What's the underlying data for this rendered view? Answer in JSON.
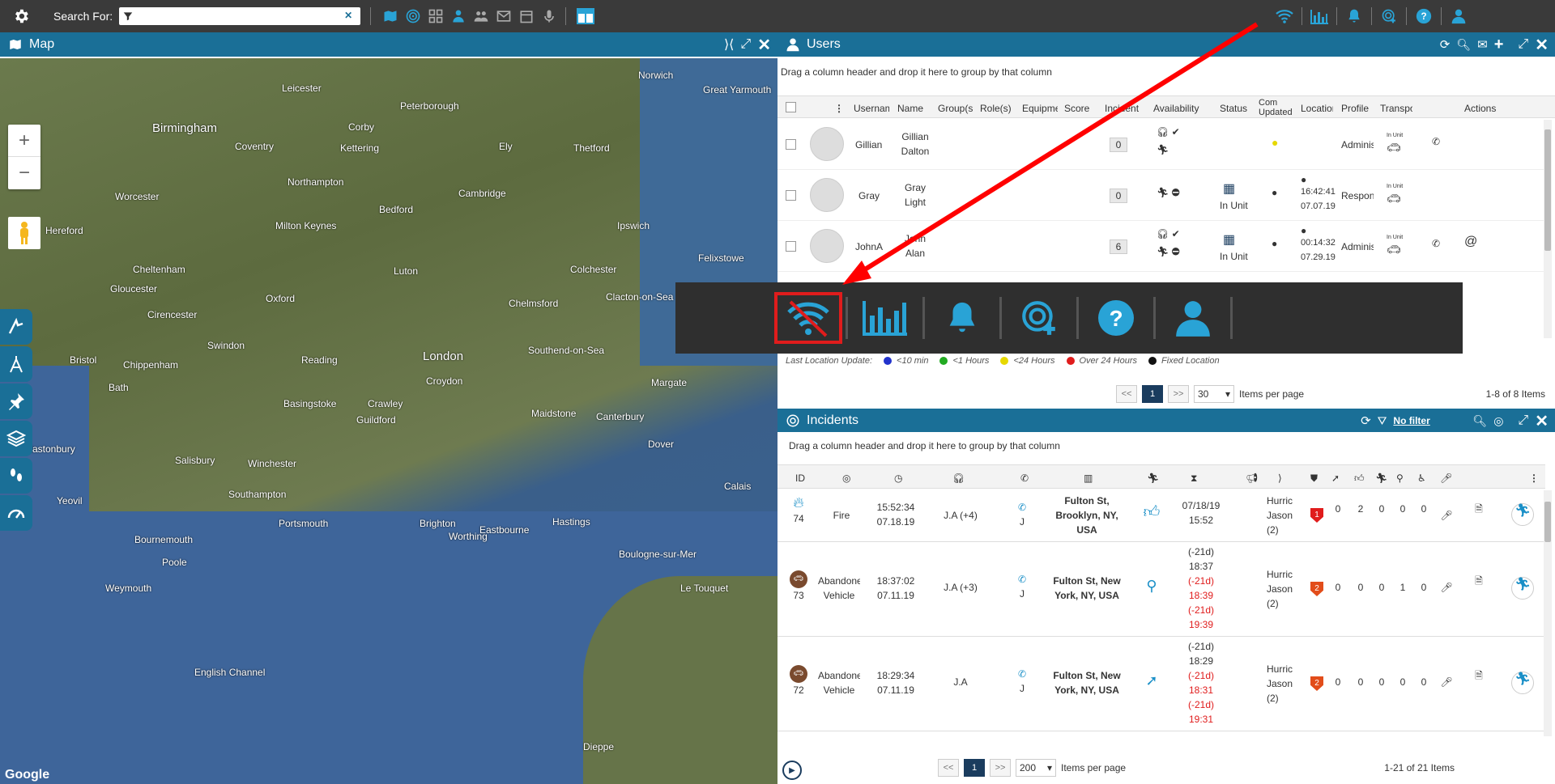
{
  "topbar": {
    "search_label": "Search For:",
    "search_value": "",
    "clear_glyph": "✕"
  },
  "map": {
    "title": "Map",
    "zoom_in": "+",
    "zoom_out": "−",
    "attribution": "Google",
    "cities": [
      {
        "name": "Birmingham",
        "big": true
      },
      {
        "name": "London",
        "big": true
      },
      {
        "name": "Norwich",
        "big": false
      },
      {
        "name": "Cambridge",
        "big": false
      },
      {
        "name": "Oxford",
        "big": false
      },
      {
        "name": "Bristol",
        "big": false
      },
      {
        "name": "Reading",
        "big": false
      },
      {
        "name": "Southampton",
        "big": false
      },
      {
        "name": "Portsmouth",
        "big": false
      },
      {
        "name": "Brighton",
        "big": false
      },
      {
        "name": "Canterbury",
        "big": false
      },
      {
        "name": "Dover",
        "big": false
      },
      {
        "name": "Ipswich",
        "big": false
      },
      {
        "name": "Chelmsford",
        "big": false
      },
      {
        "name": "Colchester",
        "big": false
      },
      {
        "name": "Northampton",
        "big": false
      },
      {
        "name": "Milton Keynes",
        "big": false
      },
      {
        "name": "Bedford",
        "big": false
      },
      {
        "name": "Luton",
        "big": false
      },
      {
        "name": "Swindon",
        "big": false
      },
      {
        "name": "Salisbury",
        "big": false
      },
      {
        "name": "Winchester",
        "big": false
      },
      {
        "name": "Bournemouth",
        "big": false
      },
      {
        "name": "Poole",
        "big": false
      },
      {
        "name": "Weymouth",
        "big": false
      },
      {
        "name": "Worthing",
        "big": false
      },
      {
        "name": "Eastbourne",
        "big": false
      },
      {
        "name": "Hastings",
        "big": false
      },
      {
        "name": "Maidstone",
        "big": false
      },
      {
        "name": "Crawley",
        "big": false
      },
      {
        "name": "Southend-on-Sea",
        "big": false
      },
      {
        "name": "Leicester",
        "big": false
      },
      {
        "name": "Peterborough",
        "big": false
      },
      {
        "name": "Coventry",
        "big": false
      },
      {
        "name": "Gloucester",
        "big": false
      },
      {
        "name": "Cheltenham",
        "big": false
      },
      {
        "name": "Hereford",
        "big": false
      },
      {
        "name": "Worcester",
        "big": false
      },
      {
        "name": "Calais",
        "big": false
      },
      {
        "name": "Boulogne-sur-Mer",
        "big": false
      },
      {
        "name": "Dieppe",
        "big": false
      },
      {
        "name": "Le Touquet",
        "big": false
      },
      {
        "name": "Margate",
        "big": false
      },
      {
        "name": "Clacton-on-Sea",
        "big": false
      },
      {
        "name": "Felixstowe",
        "big": false
      },
      {
        "name": "Great Yarmouth",
        "big": false
      },
      {
        "name": "Thetford",
        "big": false
      },
      {
        "name": "Ely",
        "big": false
      },
      {
        "name": "Kettering",
        "big": false
      },
      {
        "name": "Corby",
        "big": false
      },
      {
        "name": "Basingstoke",
        "big": false
      },
      {
        "name": "Guildford",
        "big": false
      },
      {
        "name": "Croydon",
        "big": false
      },
      {
        "name": "Bath",
        "big": false
      },
      {
        "name": "Chippenham",
        "big": false
      },
      {
        "name": "Cirencester",
        "big": false
      },
      {
        "name": "Yeovil",
        "big": false
      },
      {
        "name": "Glastonbury",
        "big": false
      },
      {
        "name": "English Channel",
        "big": false
      }
    ]
  },
  "users": {
    "title": "Users",
    "group_hint": "Drag a column header and drop it here to group by that column",
    "columns": [
      "Usernam",
      "Name",
      "Group(s",
      "Role(s)",
      "Equipme",
      "Score",
      "Incident",
      "Availability",
      "Status",
      "Com Updated",
      "Location",
      "Profile",
      "Transpo",
      "Actions"
    ],
    "rows": [
      {
        "username": "Gillian",
        "name_first": "Gillian",
        "name_last": "Dalton",
        "incidents": "0",
        "status": "",
        "loc_time": "",
        "loc_date": "",
        "profile": "Adminis",
        "transport": "In Unit"
      },
      {
        "username": "Gray",
        "name_first": "Gray",
        "name_last": "Light",
        "incidents": "0",
        "status": "In Unit",
        "loc_time": "16:42:41",
        "loc_date": "07.07.19",
        "profile": "Respon",
        "transport": "In Unit"
      },
      {
        "username": "JohnA",
        "name_first": "John",
        "name_last": "Alan",
        "incidents": "6",
        "status": "In Unit",
        "loc_time": "00:14:32",
        "loc_date": "07.29.19",
        "profile": "Adminis",
        "transport": "In Unit"
      }
    ],
    "legend": {
      "label": "Last Location Update:",
      "items": [
        {
          "label": "<10 min",
          "color": "#2233cc"
        },
        {
          "label": "<1 Hours",
          "color": "#22aa22"
        },
        {
          "label": "<24 Hours",
          "color": "#e6d800"
        },
        {
          "label": "Over 24 Hours",
          "color": "#e01c1c"
        },
        {
          "label": "Fixed Location",
          "color": "#111111"
        }
      ]
    },
    "pager": {
      "prev": "<<",
      "page": "1",
      "next": ">>",
      "per_page": "30",
      "per_page_label": "Items per page",
      "summary": "1-8 of 8 Items"
    }
  },
  "incidents": {
    "title": "Incidents",
    "filter_label": "No filter",
    "group_hint": "Drag a column header and drop it here to group by that column",
    "columns": {
      "id": "ID"
    },
    "rows": [
      {
        "id": "74",
        "type_1": "Fire",
        "type_2": "",
        "time": "15:52:34",
        "date": "07.18.19",
        "assigned": "J.A (+4)",
        "caller": "J",
        "address": "Fulton St, Brooklyn, NY, USA",
        "times": [
          {
            "label": "07/18/19",
            "color": "default"
          },
          {
            "label": "15:52",
            "color": "default"
          }
        ],
        "event_1": "Hurric",
        "event_2": "Jason",
        "event_3": "(2)",
        "priority": "1",
        "counts": [
          "0",
          "2",
          "0",
          "0",
          "0"
        ]
      },
      {
        "id": "73",
        "type_1": "Abandone",
        "type_2": "Vehicle",
        "time": "18:37:02",
        "date": "07.11.19",
        "assigned": "J.A (+3)",
        "caller": "J",
        "address": "Fulton St, New York, NY, USA",
        "times": [
          {
            "label": "(-21d)",
            "color": "default"
          },
          {
            "label": "18:37",
            "color": "default"
          },
          {
            "label": "(-21d)",
            "color": "red"
          },
          {
            "label": "18:39",
            "color": "red"
          },
          {
            "label": "(-21d)",
            "color": "red"
          },
          {
            "label": "19:39",
            "color": "red"
          }
        ],
        "event_1": "Hurric",
        "event_2": "Jason",
        "event_3": "(2)",
        "priority": "2",
        "counts": [
          "0",
          "0",
          "0",
          "1",
          "0"
        ]
      },
      {
        "id": "72",
        "type_1": "Abandone",
        "type_2": "Vehicle",
        "time": "18:29:34",
        "date": "07.11.19",
        "assigned": "J.A",
        "caller": "J",
        "address": "Fulton St, New York, NY, USA",
        "times": [
          {
            "label": "(-21d)",
            "color": "default"
          },
          {
            "label": "18:29",
            "color": "default"
          },
          {
            "label": "(-21d)",
            "color": "red"
          },
          {
            "label": "18:31",
            "color": "red"
          },
          {
            "label": "(-21d)",
            "color": "red"
          },
          {
            "label": "19:31",
            "color": "red"
          }
        ],
        "event_1": "Hurric",
        "event_2": "Jason",
        "event_3": "(2)",
        "priority": "2",
        "counts": [
          "0",
          "0",
          "0",
          "0",
          "0"
        ]
      }
    ],
    "pager": {
      "prev": "<<",
      "page": "1",
      "next": ">>",
      "per_page": "200",
      "per_page_label": "Items per page",
      "summary": "1-21 of 21 Items"
    }
  },
  "colors": {
    "accent": "#1a6f97",
    "topbar": "#3a3a3a",
    "icon_blue": "#1a8fc7",
    "alert_red": "#e01c1c"
  }
}
